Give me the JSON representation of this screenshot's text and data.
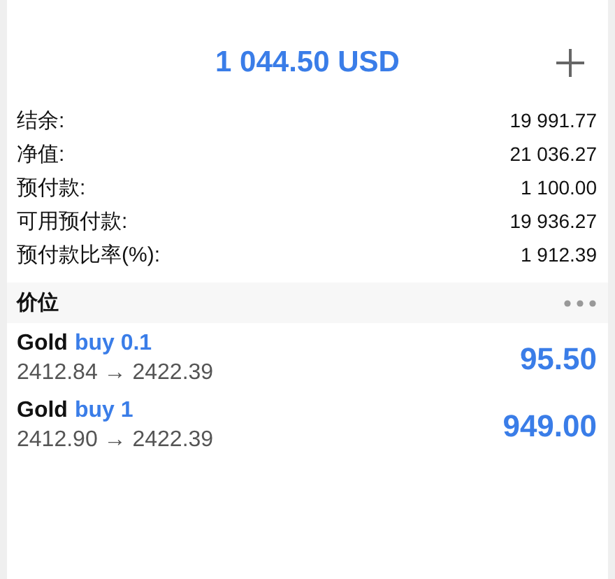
{
  "header": {
    "title": "1 044.50 USD"
  },
  "summary": [
    {
      "label": "结余:",
      "value": "19 991.77"
    },
    {
      "label": "净值:",
      "value": "21 036.27"
    },
    {
      "label": "预付款:",
      "value": "1 100.00"
    },
    {
      "label": "可用预付款:",
      "value": "19 936.27"
    },
    {
      "label": "预付款比率(%):",
      "value": "1 912.39"
    }
  ],
  "section": {
    "title": "价位"
  },
  "positions": [
    {
      "symbol": "Gold",
      "order": "buy 0.1",
      "prices": "2412.84 → 2422.39",
      "profit": "95.50"
    },
    {
      "symbol": "Gold",
      "order": "buy 1",
      "prices": "2412.90 → 2422.39",
      "profit": "949.00"
    }
  ]
}
